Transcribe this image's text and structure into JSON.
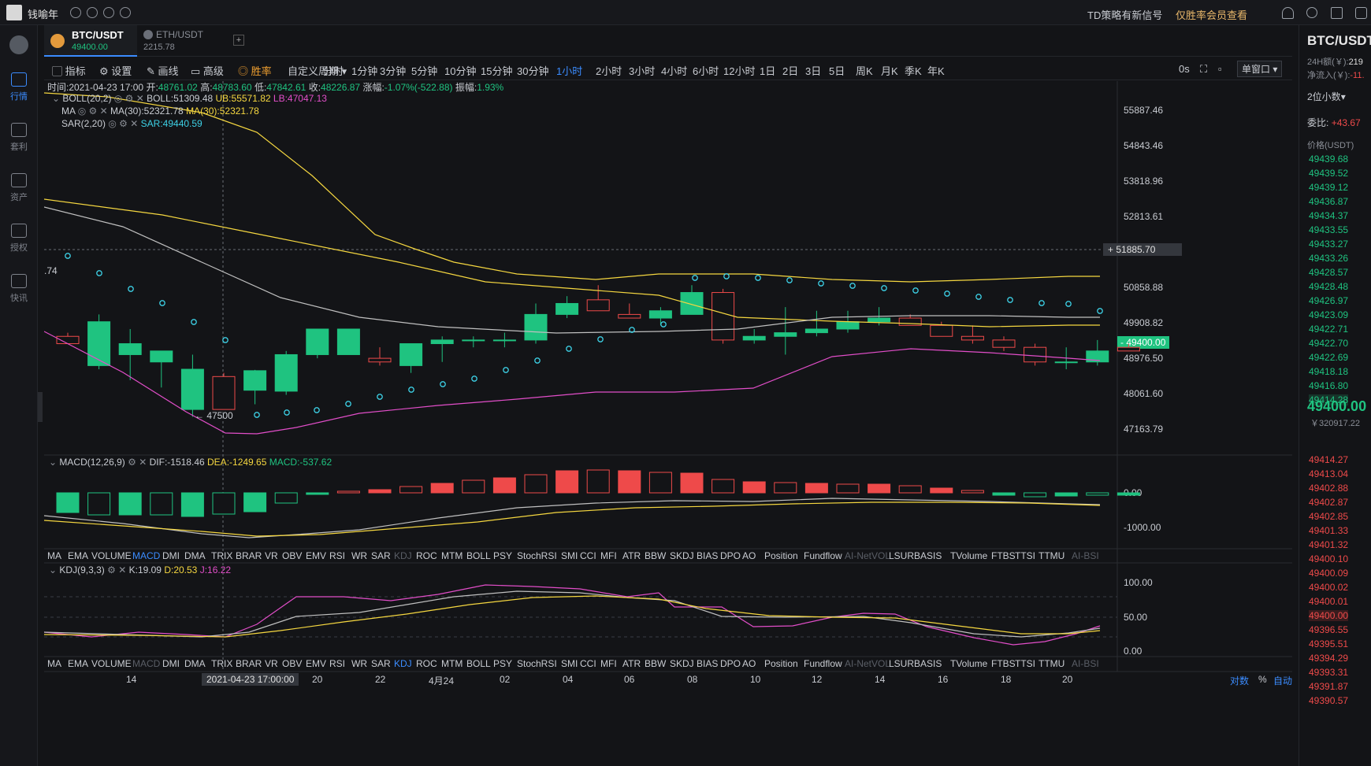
{
  "app": {
    "name": "钱喻年",
    "signal_text": "TD策略有新信号",
    "member_text": "仅胜率会员查看"
  },
  "sidebar": [
    {
      "label": "行情",
      "active": true
    },
    {
      "label": "套利",
      "active": false
    },
    {
      "label": "资产",
      "active": false
    },
    {
      "label": "授权",
      "active": false
    },
    {
      "label": "快讯",
      "active": false
    }
  ],
  "tabs": [
    {
      "symbol": "BTC/USDT",
      "price": "49400.00",
      "active": true
    },
    {
      "symbol": "ETH/USDT",
      "price": "2215.78",
      "active": false
    }
  ],
  "add_tab": "+",
  "toolbar": {
    "tools": [
      "指标",
      "设置",
      "画线",
      "高级",
      "胜率"
    ],
    "custom_period": "自定义周期",
    "periods": [
      "分时",
      "1分钟",
      "3分钟",
      "5分钟",
      "10分钟",
      "15分钟",
      "30分钟",
      "1小时",
      "2小时",
      "3小时",
      "4小时",
      "6小时",
      "12小时",
      "1日",
      "2日",
      "3日",
      "5日",
      "周K",
      "月K",
      "季K",
      "年K"
    ],
    "active_period": "1小时",
    "refresh": "0s",
    "window_mode": "单窗口"
  },
  "ohlc": {
    "time": "时间:2021-04-23 17:00",
    "open_label": "开:",
    "open": "48761.02",
    "high_label": "高:",
    "high": "48783.60",
    "low_label": "低:",
    "low": "47842.61",
    "close_label": "收:",
    "close": "48226.87",
    "change_label": "涨幅:",
    "change": "-1.07%(-522.88)",
    "amp_label": "振幅:",
    "amp": "1.93%"
  },
  "indicators": {
    "boll": {
      "name": "BOLL(20,2)",
      "boll": "BOLL:51309.48",
      "ub": "UB:55571.82",
      "lb": "LB:47047.13"
    },
    "ma": {
      "name": "MA",
      "ma30a": "MA(30):52321.78",
      "ma30b": "MA(30):52321.78"
    },
    "sar": {
      "name": "SAR(2,20)",
      "value": "SAR:49440.59"
    },
    "macd": {
      "name": "MACD(12,26,9)",
      "dif": "DIF:-1518.46",
      "dea": "DEA:-1249.65",
      "macd": "MACD:-537.62"
    },
    "kdj": {
      "name": "KDJ(9,3,3)",
      "k": "K:19.09",
      "d": "D:20.53",
      "j": "J:16.22"
    }
  },
  "price_axis": [
    "55887.46",
    "54843.46",
    "53818.96",
    "52813.61",
    "50858.88",
    "49908.82",
    "48976.50",
    "48061.60",
    "47163.79"
  ],
  "crosshair_price": "51885.70",
  "current_price_tag": "49400.00",
  "low_marker": "← 47500",
  "left_edge_label": ".74",
  "macd_axis": [
    "0.00",
    "-1000.00"
  ],
  "kdj_axis": [
    "100.00",
    "50.00",
    "0.00"
  ],
  "indicator_bar": [
    "MA",
    "EMA",
    "VOLUME",
    "MACD",
    "DMI",
    "DMA",
    "TRIX",
    "BRAR",
    "VR",
    "OBV",
    "EMV",
    "RSI",
    "WR",
    "SAR",
    "KDJ",
    "ROC",
    "MTM",
    "BOLL",
    "PSY",
    "StochRSI",
    "SMI",
    "CCI",
    "MFI",
    "ATR",
    "BBW",
    "SKDJ",
    "BIAS",
    "DPO",
    "AO",
    "Position",
    "Fundflow",
    "AI-NetVOL",
    "LSUR",
    "BASIS",
    "TVolume",
    "FTBS",
    "TTSI",
    "TTMU",
    "AI-BSI"
  ],
  "time_axis": [
    "14",
    "20",
    "22",
    "4月24",
    "02",
    "04",
    "06",
    "08",
    "10",
    "12",
    "14",
    "16",
    "18",
    "20"
  ],
  "time_highlight": "2021-04-23 17:00:00",
  "axis_options": [
    "对数",
    "%",
    "自动"
  ],
  "right": {
    "symbol": "BTC/USDT",
    "vol_label": "24H额(￥):",
    "vol": "219",
    "inflow_label": "净流入(￥):",
    "inflow": "-11.",
    "precision": "2位小数",
    "ratio_label": "委比:",
    "ratio": "+43.67",
    "price_header": "价格(USDT)",
    "asks": [
      "49439.68",
      "49439.52",
      "49439.12",
      "49436.87",
      "49434.37",
      "49433.55",
      "49433.27",
      "49433.26",
      "49428.57",
      "49428.48",
      "49426.97",
      "49423.09",
      "49422.71",
      "49422.70",
      "49422.69",
      "49418.18",
      "49416.80",
      "49414.28"
    ],
    "last": "49400.00",
    "last_cny": "￥320917.22",
    "bids": [
      "49414.27",
      "49413.04",
      "49402.88",
      "49402.87",
      "49402.85",
      "49401.33",
      "49401.32",
      "49400.10",
      "49400.09",
      "49400.02",
      "49400.01",
      "49400.00",
      "49396.55",
      "49395.51",
      "49394.29",
      "49393.31",
      "49391.87",
      "49390.57"
    ]
  },
  "colors": {
    "up": "#1fc380",
    "down": "#ee4a4a",
    "accent": "#3b8cff",
    "boll_mid": "#c0c0c0",
    "ma": "#f5d740",
    "lb": "#e24ec9",
    "sar": "#3dd1e6"
  },
  "chart_data": {
    "type": "candlestick",
    "candles": [
      {
        "o": 49700,
        "h": 49800,
        "l": 49500,
        "c": 49500
      },
      {
        "o": 48900,
        "h": 50300,
        "l": 48800,
        "c": 50100
      },
      {
        "o": 49200,
        "h": 49900,
        "l": 48500,
        "c": 49500
      },
      {
        "o": 49000,
        "h": 49300,
        "l": 48300,
        "c": 49300
      },
      {
        "o": 47700,
        "h": 49200,
        "l": 47500,
        "c": 48800
      },
      {
        "o": 48600,
        "h": 48700,
        "l": 47900,
        "c": 47700
      },
      {
        "o": 48226,
        "h": 48783,
        "l": 47842,
        "c": 48761
      },
      {
        "o": 48200,
        "h": 49300,
        "l": 48100,
        "c": 49200
      },
      {
        "o": 49200,
        "h": 49900,
        "l": 49100,
        "c": 49900
      },
      {
        "o": 49200,
        "h": 49900,
        "l": 49200,
        "c": 49900
      },
      {
        "o": 49100,
        "h": 49400,
        "l": 48900,
        "c": 49000
      },
      {
        "o": 48900,
        "h": 49500,
        "l": 48700,
        "c": 49500
      },
      {
        "o": 49500,
        "h": 49700,
        "l": 49000,
        "c": 49600
      },
      {
        "o": 49600,
        "h": 49700,
        "l": 49400,
        "c": 49600
      },
      {
        "o": 49600,
        "h": 49800,
        "l": 49400,
        "c": 49600
      },
      {
        "o": 49600,
        "h": 50600,
        "l": 49500,
        "c": 50300
      },
      {
        "o": 50300,
        "h": 50800,
        "l": 50200,
        "c": 50600
      },
      {
        "o": 50700,
        "h": 51100,
        "l": 50400,
        "c": 50400
      },
      {
        "o": 50300,
        "h": 50600,
        "l": 50200,
        "c": 50200
      },
      {
        "o": 50200,
        "h": 50500,
        "l": 50000,
        "c": 50400
      },
      {
        "o": 50300,
        "h": 51100,
        "l": 50300,
        "c": 50900
      },
      {
        "o": 50900,
        "h": 51000,
        "l": 49500,
        "c": 49600
      },
      {
        "o": 49600,
        "h": 49900,
        "l": 49500,
        "c": 49700
      },
      {
        "o": 49700,
        "h": 50500,
        "l": 49200,
        "c": 49800
      },
      {
        "o": 49800,
        "h": 50400,
        "l": 49700,
        "c": 49900
      },
      {
        "o": 49900,
        "h": 50400,
        "l": 49800,
        "c": 50100
      },
      {
        "o": 50100,
        "h": 50500,
        "l": 50000,
        "c": 50200
      },
      {
        "o": 50200,
        "h": 50300,
        "l": 50000,
        "c": 50000
      },
      {
        "o": 50000,
        "h": 50100,
        "l": 49700,
        "c": 49700
      },
      {
        "o": 49700,
        "h": 50000,
        "l": 49500,
        "c": 49600
      },
      {
        "o": 49600,
        "h": 49700,
        "l": 49300,
        "c": 49400
      },
      {
        "o": 49400,
        "h": 49500,
        "l": 48900,
        "c": 49000
      },
      {
        "o": 49000,
        "h": 49400,
        "l": 48800,
        "c": 49000
      },
      {
        "o": 49000,
        "h": 49600,
        "l": 48900,
        "c": 49300
      },
      {
        "o": 49400,
        "h": 49500,
        "l": 49300,
        "c": 49300
      }
    ]
  }
}
